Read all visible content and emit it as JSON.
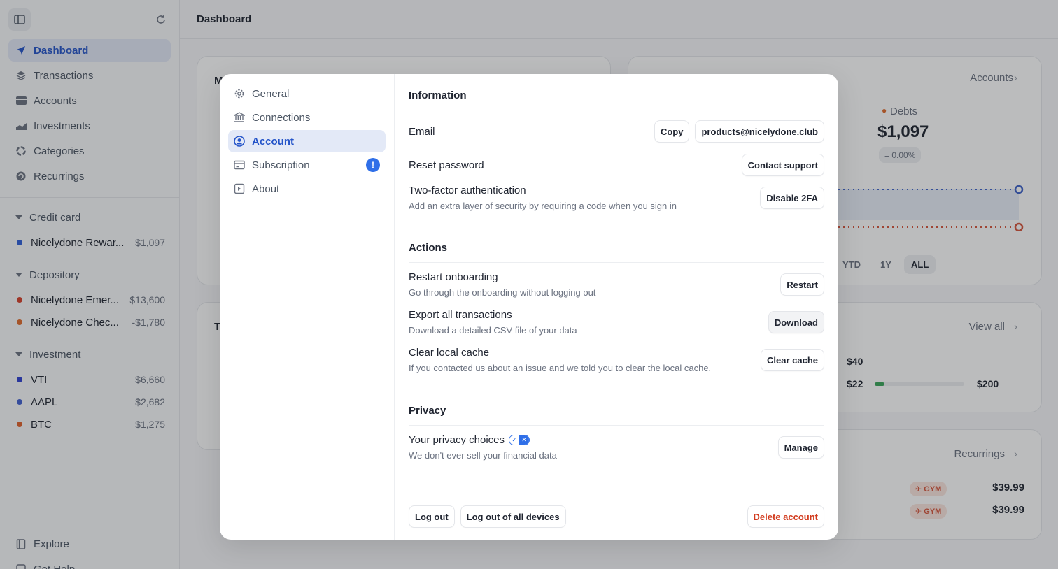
{
  "topbar": {
    "title": "Dashboard"
  },
  "sidebar": {
    "nav": [
      {
        "label": "Dashboard",
        "icon": "send-icon",
        "active": true
      },
      {
        "label": "Transactions",
        "icon": "layers-icon"
      },
      {
        "label": "Accounts",
        "icon": "card-icon"
      },
      {
        "label": "Investments",
        "icon": "chart-icon"
      },
      {
        "label": "Categories",
        "icon": "pie-icon"
      },
      {
        "label": "Recurrings",
        "icon": "recurring-icon"
      }
    ],
    "groups": [
      {
        "label": "Credit card",
        "accounts": [
          {
            "name": "Nicelydone Rewar...",
            "value": "$1,097",
            "color": "#2f5fd8"
          }
        ]
      },
      {
        "label": "Depository",
        "accounts": [
          {
            "name": "Nicelydone Emer...",
            "value": "$13,600",
            "color": "#d6402a"
          },
          {
            "name": "Nicelydone Chec...",
            "value": "-$1,780",
            "color": "#e06a2c"
          }
        ]
      },
      {
        "label": "Investment",
        "accounts": [
          {
            "name": "VTI",
            "value": "$6,660",
            "color": "#2f3fd0"
          },
          {
            "name": "AAPL",
            "value": "$2,682",
            "color": "#3f5fd0"
          },
          {
            "name": "BTC",
            "value": "$1,275",
            "color": "#e0602a"
          }
        ]
      }
    ],
    "bottom": [
      {
        "label": "Explore"
      },
      {
        "label": "Get Help"
      }
    ]
  },
  "background": {
    "card1_initial": "M",
    "card2_initial": "T",
    "accounts_link": "Accounts",
    "debts_label": "Debts",
    "debts_value": "$1,097",
    "debts_change": "= 0.00%",
    "ranges": [
      "YTD",
      "1Y",
      "ALL"
    ],
    "view_all": "View all",
    "budget_top": "$40",
    "budget_spent": "$22",
    "budget_limit": "$200",
    "budget_fraction": 0.11,
    "recurrings_link": "Recurrings",
    "recurrings": [
      {
        "tag": "GYM",
        "amount": "$39.99"
      },
      {
        "tag": "GYM",
        "amount": "$39.99"
      }
    ]
  },
  "modal": {
    "nav": [
      {
        "label": "General",
        "icon": "gear-icon"
      },
      {
        "label": "Connections",
        "icon": "bank-icon"
      },
      {
        "label": "Account",
        "icon": "user-circle-icon",
        "active": true
      },
      {
        "label": "Subscription",
        "icon": "credit-card-icon",
        "badge": "!"
      },
      {
        "label": "About",
        "icon": "info-box-icon"
      }
    ],
    "information": {
      "title": "Information",
      "email_label": "Email",
      "copy_label": "Copy",
      "email_value": "products@nicelydone.club",
      "reset_label": "Reset password",
      "contact_label": "Contact support",
      "twofa_label": "Two-factor authentication",
      "twofa_sub": "Add an extra layer of security by requiring a code when you sign in",
      "twofa_button": "Disable 2FA"
    },
    "actions": {
      "title": "Actions",
      "restart_label": "Restart onboarding",
      "restart_sub": "Go through the onboarding without logging out",
      "restart_button": "Restart",
      "export_label": "Export all transactions",
      "export_sub": "Download a detailed CSV file of your data",
      "export_button": "Download",
      "cache_label": "Clear local cache",
      "cache_sub": "If you contacted us about an issue and we told you to clear the local cache.",
      "cache_button": "Clear cache"
    },
    "privacy": {
      "title": "Privacy",
      "choices_label": "Your privacy choices",
      "choices_sub": "We don't ever sell your financial data",
      "manage_button": "Manage"
    },
    "footer": {
      "logout": "Log out",
      "logout_all": "Log out of all devices",
      "delete": "Delete account"
    }
  }
}
